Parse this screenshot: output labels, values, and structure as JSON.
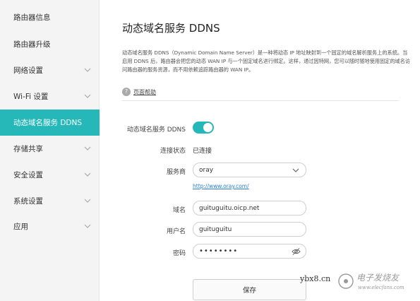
{
  "sidebar": {
    "items": [
      {
        "label": "路由器信息",
        "has_chevron": false
      },
      {
        "label": "路由器升级",
        "has_chevron": false
      },
      {
        "label": "网络设置",
        "has_chevron": true
      },
      {
        "label": "Wi-Fi 设置",
        "has_chevron": true
      },
      {
        "label": "动态域名服务 DDNS",
        "has_chevron": false,
        "active": true
      },
      {
        "label": "存储共享",
        "has_chevron": true
      },
      {
        "label": "安全设置",
        "has_chevron": true
      },
      {
        "label": "系统设置",
        "has_chevron": true
      },
      {
        "label": "应用",
        "has_chevron": true
      }
    ],
    "active_color": "#26b8b8"
  },
  "main": {
    "title": "动态域名服务 DDNS",
    "description": "动态域名服务 DDNS（Dynamic Domain Name Server）是一种将动态 IP 地址映射到一个固定的域名解析服务上的系统。当启用 DDNS 后，路由器会把您的动态 WAN IP 与一个固定域名进行绑定。这样，通过因特网，您可以随时随地使用固定的域名访问路由器的服务资源，而不用依赖追踪路由器的 WAN IP。",
    "help": {
      "icon": "question-circle-icon",
      "label": "页面帮助"
    }
  },
  "form": {
    "ddns_label": "动态域名服务 DDNS",
    "ddns_enabled": true,
    "status_label": "连接状态",
    "status_value": "已连接",
    "provider_label": "服务商",
    "provider_value": "oray",
    "provider_link": "http://www.oray.com/",
    "domain_label": "域名",
    "domain_value": "guituguitu.oicp.net",
    "username_label": "用户名",
    "username_value": "guituguitu",
    "password_label": "密码",
    "password_value": "••••••••",
    "save_label": "保存"
  },
  "watermark": {
    "left_text": "ybx8.cn",
    "brand_text": "电子发烧友",
    "brand_url": "www.elecfans.com"
  },
  "colors": {
    "accent": "#26b8b8",
    "link": "#2a7fd0"
  }
}
